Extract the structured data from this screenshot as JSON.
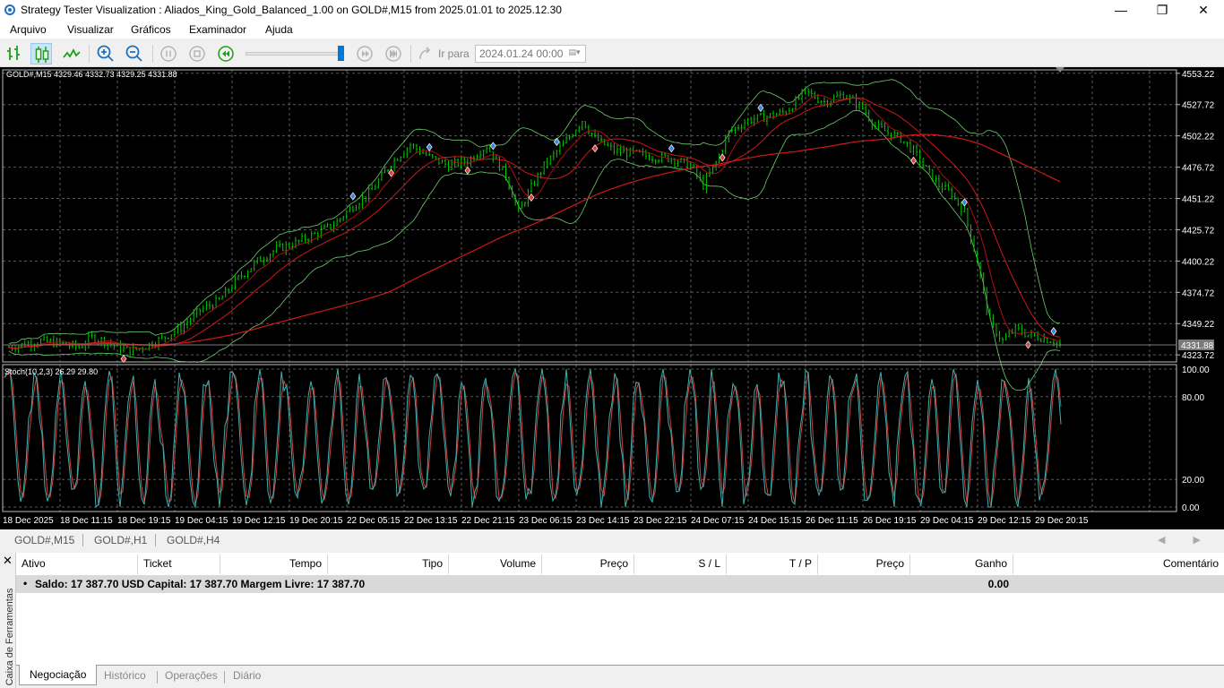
{
  "window": {
    "title": "Strategy Tester Visualization : Aliados_King_Gold_Balanced_1.00 on GOLD#,M15 from 2025.01.01 to 2025.12.30",
    "minimize": "—",
    "maximize": "❐",
    "close": "✕"
  },
  "menu": [
    "Arquivo",
    "Visualizar",
    "Gráficos",
    "Examinador",
    "Ajuda"
  ],
  "toolbar": {
    "icons": [
      "bar-chart-icon",
      "candlestick-icon",
      "line-chart-icon",
      "zoom-in-icon",
      "zoom-out-icon",
      "pause-icon",
      "stop-icon",
      "rewind-icon",
      "step-icon",
      "fast-forward-icon",
      "goto-icon"
    ],
    "goto_label": "Ir para",
    "goto_date": "2024.01.24 00:00",
    "speed_level": 1.0
  },
  "chart": {
    "info": "GOLD#,M15  4329.46 4332.73 4329.25 4331.88",
    "price_ticks": [
      "4553.22",
      "4527.72",
      "4502.22",
      "4476.72",
      "4451.22",
      "4425.72",
      "4400.22",
      "4374.72",
      "4349.22",
      "4323.72"
    ],
    "current_price": "4331.88",
    "indicator_label": "Stoch(10,2,3) 26.29 29.80",
    "stoch_ticks": [
      "100.00",
      "80.00",
      "20.00",
      "0.00"
    ],
    "time_ticks": [
      "18 Dec 2025",
      "18 Dec 11:15",
      "18 Dec 19:15",
      "19 Dec 04:15",
      "19 Dec 12:15",
      "19 Dec 20:15",
      "22 Dec 05:15",
      "22 Dec 13:15",
      "22 Dec 21:15",
      "23 Dec 06:15",
      "23 Dec 14:15",
      "23 Dec 22:15",
      "24 Dec 07:15",
      "24 Dec 15:15",
      "26 Dec 11:15",
      "26 Dec 19:15",
      "29 Dec 04:15",
      "29 Dec 12:15",
      "29 Dec 20:15"
    ],
    "colors": {
      "background": "#000000",
      "grid": "#5a5a5a",
      "candles": "#00c800",
      "ma": "#d01818",
      "bands": "#6ccd6c",
      "stoch_main": "#3fb0b0",
      "stoch_signal": "#d04040"
    }
  },
  "chart_data": {
    "type": "candlestick",
    "symbol": "GOLD#",
    "timeframe": "M15",
    "ylim": [
      4315,
      4555
    ],
    "close_path": [
      [
        0,
        4330
      ],
      [
        5,
        4335
      ],
      [
        8,
        4333
      ],
      [
        11,
        4330
      ],
      [
        13,
        4338
      ],
      [
        15,
        4335
      ],
      [
        17,
        4330
      ],
      [
        19,
        4327
      ],
      [
        21,
        4330
      ],
      [
        24,
        4337
      ],
      [
        27,
        4346
      ],
      [
        30,
        4360
      ],
      [
        33,
        4368
      ],
      [
        36,
        4386
      ],
      [
        39,
        4400
      ],
      [
        42,
        4410
      ],
      [
        45,
        4415
      ],
      [
        48,
        4422
      ],
      [
        51,
        4430
      ],
      [
        54,
        4445
      ],
      [
        57,
        4458
      ],
      [
        60,
        4480
      ],
      [
        63,
        4495
      ],
      [
        66,
        4485
      ],
      [
        69,
        4478
      ],
      [
        72,
        4482
      ],
      [
        75,
        4494
      ],
      [
        78,
        4470
      ],
      [
        80,
        4440
      ],
      [
        82,
        4460
      ],
      [
        84,
        4478
      ],
      [
        87,
        4495
      ],
      [
        90,
        4515
      ],
      [
        92,
        4500
      ],
      [
        95,
        4490
      ],
      [
        98,
        4488
      ],
      [
        101,
        4485
      ],
      [
        104,
        4484
      ],
      [
        107,
        4478
      ],
      [
        109,
        4462
      ],
      [
        111,
        4480
      ],
      [
        113,
        4505
      ],
      [
        116,
        4515
      ],
      [
        119,
        4518
      ],
      [
        122,
        4522
      ],
      [
        125,
        4538
      ],
      [
        128,
        4530
      ],
      [
        131,
        4536
      ],
      [
        134,
        4525
      ],
      [
        136,
        4510
      ],
      [
        138,
        4505
      ],
      [
        140,
        4500
      ],
      [
        142,
        4490
      ],
      [
        144,
        4475
      ],
      [
        146,
        4462
      ],
      [
        148,
        4455
      ],
      [
        150,
        4440
      ],
      [
        152,
        4400
      ],
      [
        154,
        4350
      ],
      [
        156,
        4335
      ],
      [
        158,
        4345
      ],
      [
        160,
        4340
      ],
      [
        162,
        4338
      ],
      [
        164,
        4335
      ],
      [
        165,
        4332
      ]
    ],
    "stoch_lines": [
      80,
      20
    ]
  },
  "symbol_tabs": [
    "GOLD#,M15",
    "GOLD#,H1",
    "GOLD#,H4"
  ],
  "symbol_nav": "◀ ▶",
  "toolbox": {
    "close": "✕",
    "side_label": "Caixa de Ferramentas",
    "columns": [
      "Ativo",
      "Ticket",
      "Tempo",
      "Tipo",
      "Volume",
      "Preço",
      "S / L",
      "T / P",
      "Preço",
      "Ganho",
      "Comentário"
    ],
    "balance_bullet": "•",
    "balance_text": "Saldo: 17 387.70 USD  Capital: 17 387.70  Margem Livre: 17 387.70",
    "balance_profit": "0.00",
    "tabs": [
      "Negociação",
      "Histórico",
      "Operações",
      "Diário"
    ]
  }
}
